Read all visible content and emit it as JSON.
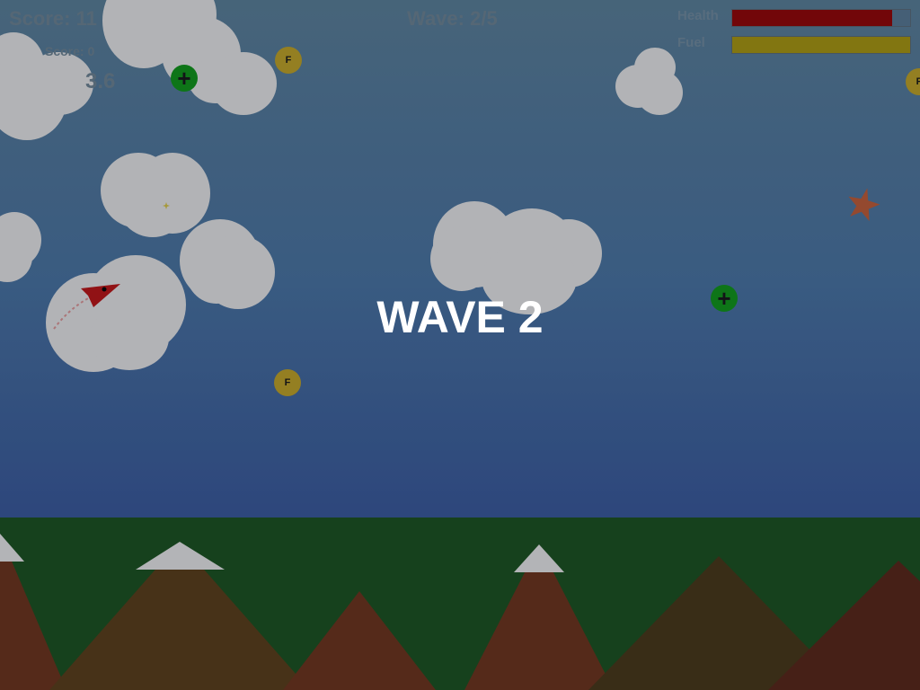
{
  "hud": {
    "score": "Score: 11",
    "hi_score": "Score: 0",
    "timer": "3.6",
    "wave": "Wave: 2/5"
  },
  "bars": {
    "health": {
      "label": "Health",
      "value": 0.9,
      "color": "#7d0000"
    },
    "fuel": {
      "label": "Fuel",
      "value": 1.0,
      "color": "#8f800a"
    }
  },
  "pickups": {
    "fuel_symbol": "F",
    "health_symbol": "+"
  },
  "banner": "WAVE 2",
  "colors": {
    "player": "#a00e0e",
    "enemy": "#a34d2c",
    "cloud": "#c5c5c5",
    "ground": "#144417",
    "snow": "#c7c7c7"
  }
}
